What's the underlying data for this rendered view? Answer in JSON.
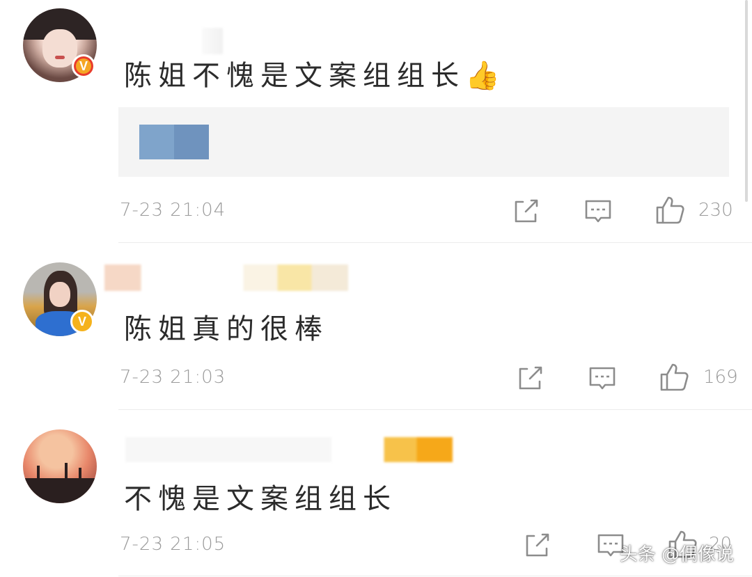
{
  "comments": [
    {
      "text": "陈姐不愧是文案组组长👍",
      "badge": "V",
      "time": "7-23 21:04",
      "likes": "230"
    },
    {
      "text": "陈姐真的很棒",
      "badge": "V",
      "time": "7-23 21:03",
      "likes": "169"
    },
    {
      "text": "不愧是文案组组长",
      "time": "7-23 21:05",
      "likes": "20"
    }
  ],
  "icons": {
    "share": "share-icon",
    "reply": "comment-icon",
    "like": "thumbs-up-icon"
  },
  "watermark": "头条 @偶像说",
  "colors": {
    "badge_red": "#e83a2e",
    "badge_gold": "#f5b21c",
    "quote_bg": "#f4f4f4",
    "meta_gray": "#9a9a9a"
  }
}
